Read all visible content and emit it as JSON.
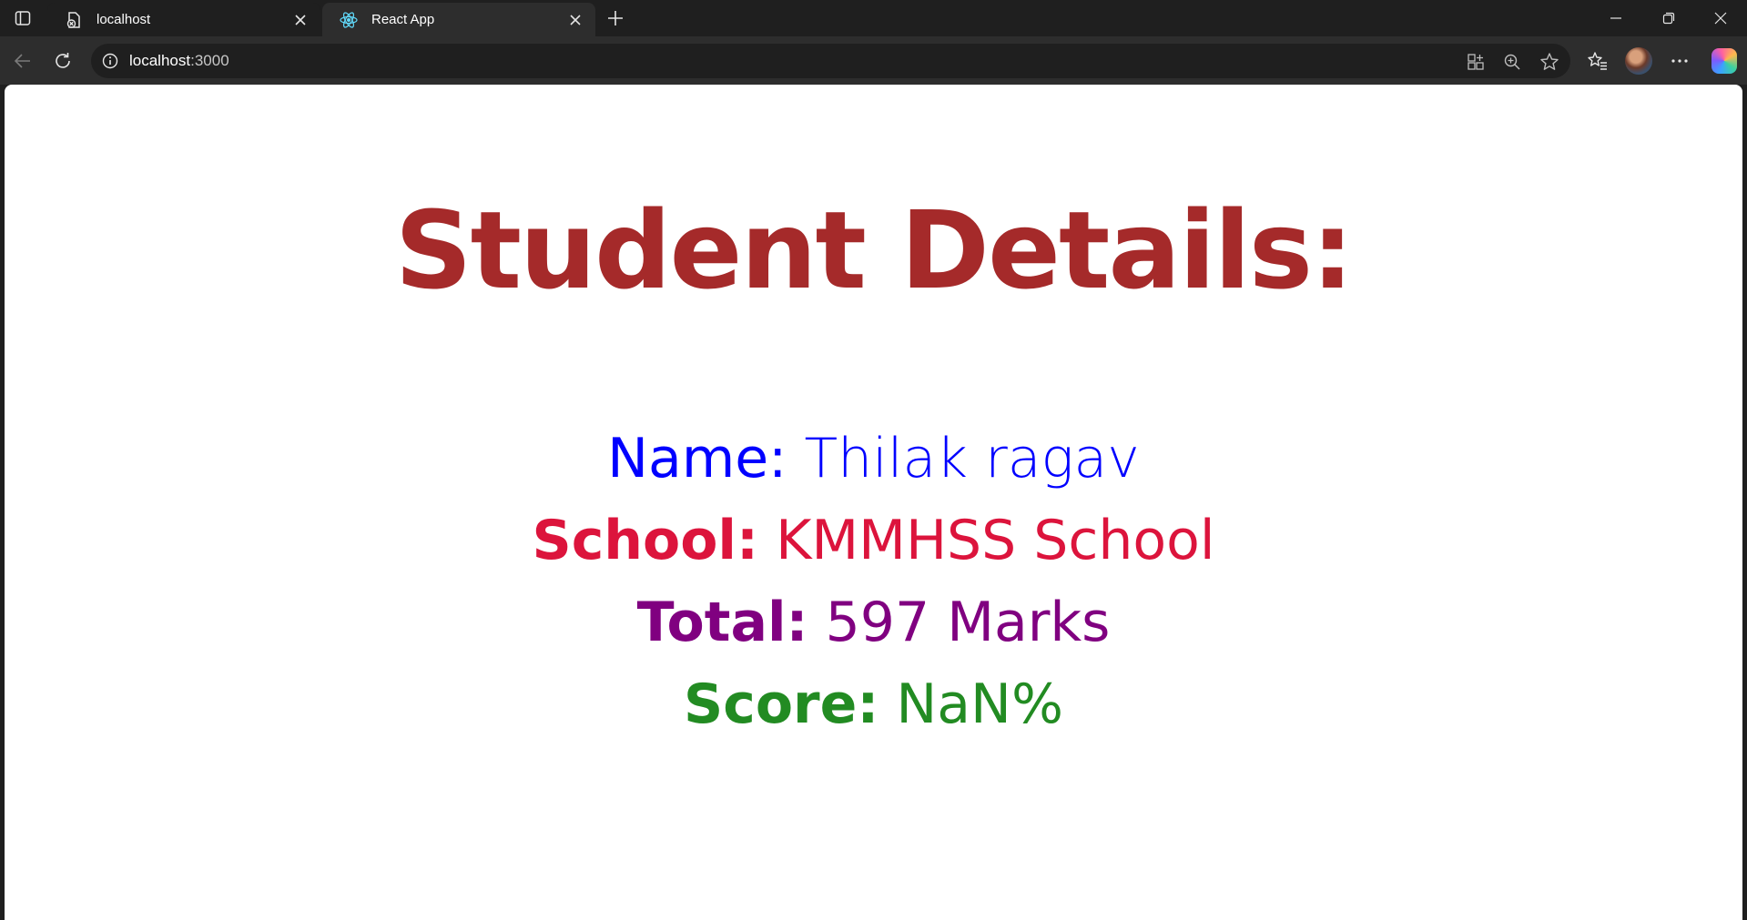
{
  "browser": {
    "tabs": [
      {
        "label": "localhost",
        "active": false,
        "icon": "page-blocked-icon"
      },
      {
        "label": "React App",
        "active": true,
        "icon": "react-icon"
      }
    ],
    "address": {
      "host": "localhost",
      "port": ":3000"
    }
  },
  "page": {
    "heading": "Student Details:",
    "fields": {
      "name": {
        "label": "Name:",
        "value": "Thilak ragav",
        "color": "#0000ff"
      },
      "school": {
        "label": "School:",
        "value": "KMMHSS School",
        "color": "#dc143c"
      },
      "total": {
        "label": "Total:",
        "value": "597 Marks",
        "color": "#800080"
      },
      "score": {
        "label": "Score:",
        "value": "NaN%",
        "color": "#228b22"
      }
    },
    "heading_color": "#a52a2a"
  }
}
